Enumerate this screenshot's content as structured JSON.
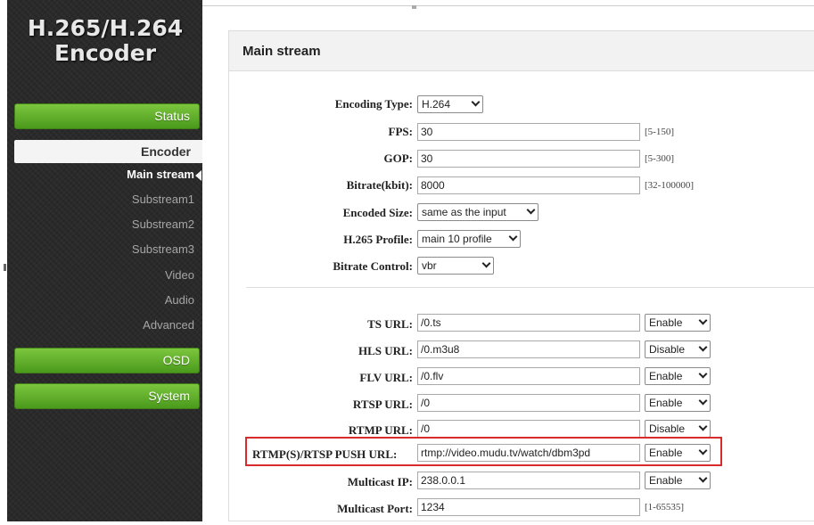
{
  "sidebar": {
    "logo_line1": "H.265/H.264",
    "logo_line2": "Encoder",
    "status_label": "Status",
    "encoder_label": "Encoder",
    "sub_items": [
      "Main stream",
      "Substream1",
      "Substream2",
      "Substream3",
      "Video",
      "Audio",
      "Advanced"
    ],
    "osd_label": "OSD",
    "system_label": "System"
  },
  "panel": {
    "title": "Main stream",
    "encoding_type": {
      "label": "Encoding Type:",
      "value": "H.264"
    },
    "fps": {
      "label": "FPS:",
      "value": "30",
      "hint": "[5-150]"
    },
    "gop": {
      "label": "GOP:",
      "value": "30",
      "hint": "[5-300]"
    },
    "bitrate": {
      "label": "Bitrate(kbit):",
      "value": "8000",
      "hint": "[32-100000]"
    },
    "encoded_size": {
      "label": "Encoded Size:",
      "value": "same as the input"
    },
    "h265_profile": {
      "label": "H.265 Profile:",
      "value": "main 10 profile"
    },
    "bitrate_control": {
      "label": "Bitrate Control:",
      "value": "vbr"
    },
    "ts_url": {
      "label": "TS URL:",
      "value": "/0.ts",
      "state": "Enable"
    },
    "hls_url": {
      "label": "HLS URL:",
      "value": "/0.m3u8",
      "state": "Disable"
    },
    "flv_url": {
      "label": "FLV URL:",
      "value": "/0.flv",
      "state": "Enable"
    },
    "rtsp_url": {
      "label": "RTSP URL:",
      "value": "/0",
      "state": "Enable"
    },
    "rtmp_url": {
      "label": "RTMP URL:",
      "value": "/0",
      "state": "Disable"
    },
    "push_url": {
      "label": "RTMP(S)/RTSP PUSH URL:",
      "value": "rtmp://video.mudu.tv/watch/dbm3pd",
      "state": "Enable"
    },
    "multicast_ip": {
      "label": "Multicast IP:",
      "value": "238.0.0.1",
      "state": "Enable"
    },
    "multicast_port": {
      "label": "Multicast Port:",
      "value": "1234",
      "hint": "[1-65535]"
    }
  },
  "colors": {
    "accent_green": "#5aab24",
    "highlight_red": "#d92b2b",
    "sidebar_bg": "#2a2a2a"
  }
}
